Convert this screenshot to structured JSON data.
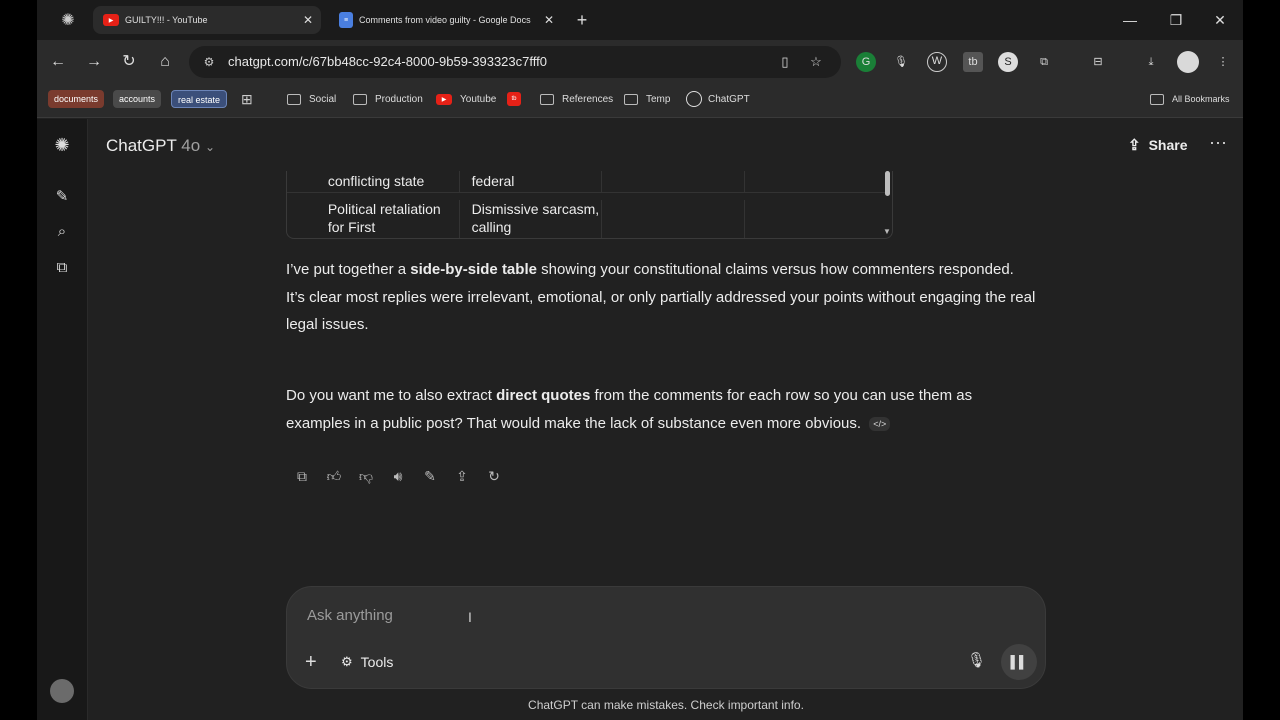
{
  "tabs": [
    {
      "title": "GUILTY!!! - YouTube",
      "favicon": "youtube-icon",
      "active": true
    },
    {
      "title": "Comments from video guilty - Google Docs",
      "favicon": "docs-icon",
      "active": false
    }
  ],
  "toolbar": {
    "url": "chatgpt.com/c/67bb48cc-92c4-8000-9b59-393323c7fff0"
  },
  "bookmarks": {
    "chips": [
      {
        "label": "documents",
        "color": "#7a3b2e"
      },
      {
        "label": "accounts",
        "color": "#4a4a4a"
      },
      {
        "label": "real estate",
        "color": "#3b4f7a"
      }
    ],
    "items": [
      "Social",
      "Production",
      "Youtube",
      "References",
      "Temp",
      "ChatGPT"
    ],
    "all_bookmarks": "All Bookmarks"
  },
  "header": {
    "model": "ChatGPT",
    "version": "4o",
    "share": "Share"
  },
  "table": {
    "rows": [
      [
        "conflicting state",
        "federal",
        "",
        ""
      ],
      [
        "Political retaliation for First",
        "Dismissive sarcasm, calling",
        "",
        ""
      ]
    ]
  },
  "message": {
    "p1_a": "I’ve put together a ",
    "p1_b": "side-by-side table",
    "p1_c": " showing your constitutional claims versus how commenters responded.",
    "p1_d": "It’s clear most replies were irrelevant, emotional, or only partially addressed your points without engaging the real legal issues.",
    "p2_a": "Do you want me to also extract ",
    "p2_b": "direct quotes",
    "p2_c": " from the comments for each row so you can use them as examples in a public post? That would make the lack of substance even more obvious.",
    "badge": "</>"
  },
  "composer": {
    "placeholder": "Ask anything",
    "tools": "Tools"
  },
  "disclaimer": "ChatGPT can make mistakes. Check important info."
}
